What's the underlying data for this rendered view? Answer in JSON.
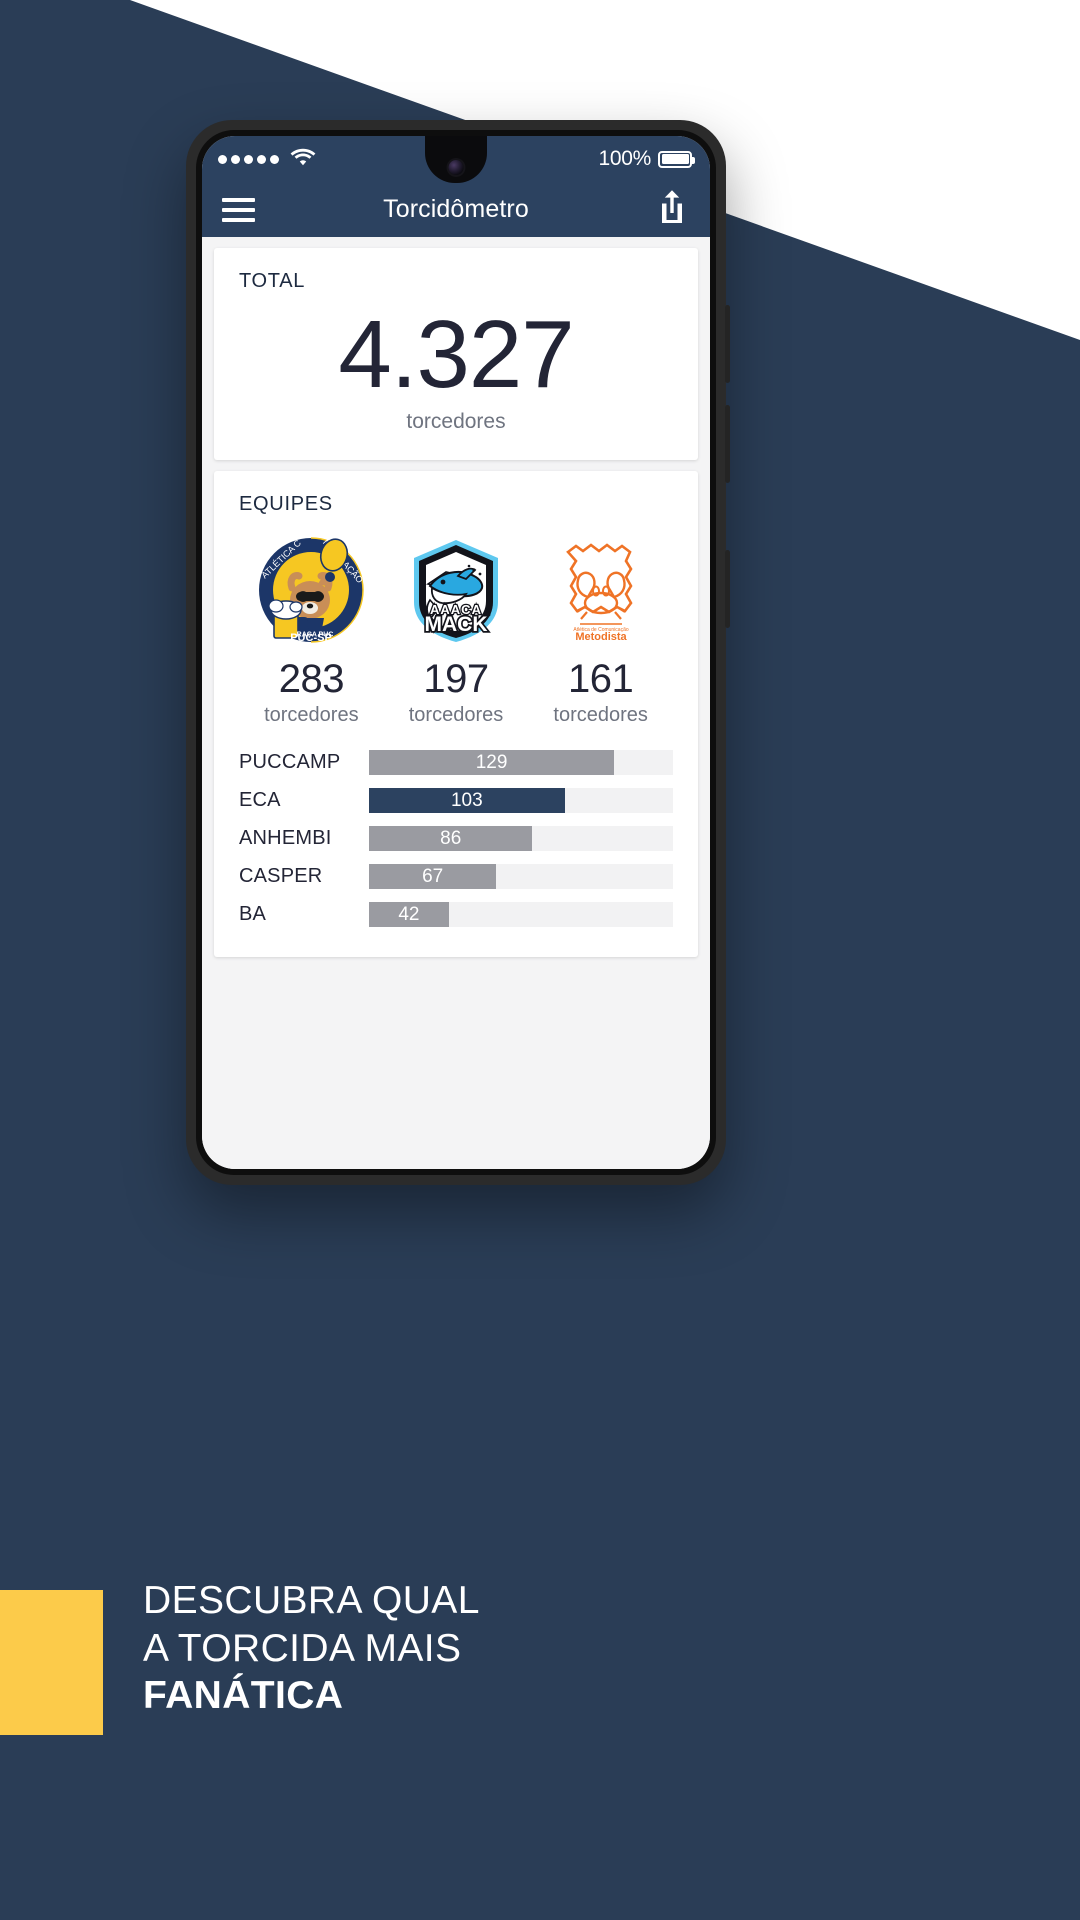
{
  "phone": {
    "statusbar": {
      "signal_dots": 5,
      "wifi_icon": "wifi-icon",
      "battery_percent": "100%"
    },
    "appbar": {
      "menu_icon": "hamburger-menu-icon",
      "title": "Torcidômetro",
      "share_icon": "share-icon"
    }
  },
  "total_card": {
    "label": "TOTAL",
    "value": "4.327",
    "unit": "torcedores"
  },
  "equipes_card": {
    "label": "EQUIPES",
    "teams": [
      {
        "logo_name": "atletica-comunicacao-puc-sp-logo",
        "logo_text": "ATLÉTICA COMUNICAÇÃO PUC-SP",
        "count": "283",
        "unit": "torcedores"
      },
      {
        "logo_name": "aaaca-mack-logo",
        "logo_text": "AAACA MACK",
        "count": "197",
        "unit": "torcedores"
      },
      {
        "logo_name": "atletica-comunicacao-metodista-logo",
        "logo_text": "Atlética de Comunicação Metodista",
        "count": "161",
        "unit": "torcedores"
      }
    ]
  },
  "chart_data": {
    "type": "bar",
    "orientation": "horizontal",
    "title": "EQUIPES",
    "xlabel": "",
    "ylabel": "",
    "categories": [
      "PUCCAMP",
      "ECA",
      "ANHEMBI",
      "CASPER",
      "BA"
    ],
    "values": [
      129,
      103,
      86,
      67,
      42
    ],
    "labels": [
      "129",
      "103",
      "86",
      "67",
      "42"
    ],
    "colors": [
      "#9a9ba1",
      "#2c4260",
      "#9a9ba1",
      "#9a9ba1",
      "#9a9ba1"
    ],
    "highlight_index": 1,
    "track_color": "#f2f2f3",
    "xlim": [
      0,
      160
    ],
    "grid": false,
    "legend": false
  },
  "marketing": {
    "line1": "DESCUBRA QUAL",
    "line2": "A TORCIDA MAIS",
    "line3": "FANÁTICA"
  },
  "colors": {
    "background": "#2a3d56",
    "wedge": "#ffffff",
    "brand_navy": "#2c4260",
    "accent_yellow": "#fccb4a",
    "bar_gray": "#9a9ba1",
    "text_dark": "#232536",
    "text_muted": "#6f7480"
  }
}
